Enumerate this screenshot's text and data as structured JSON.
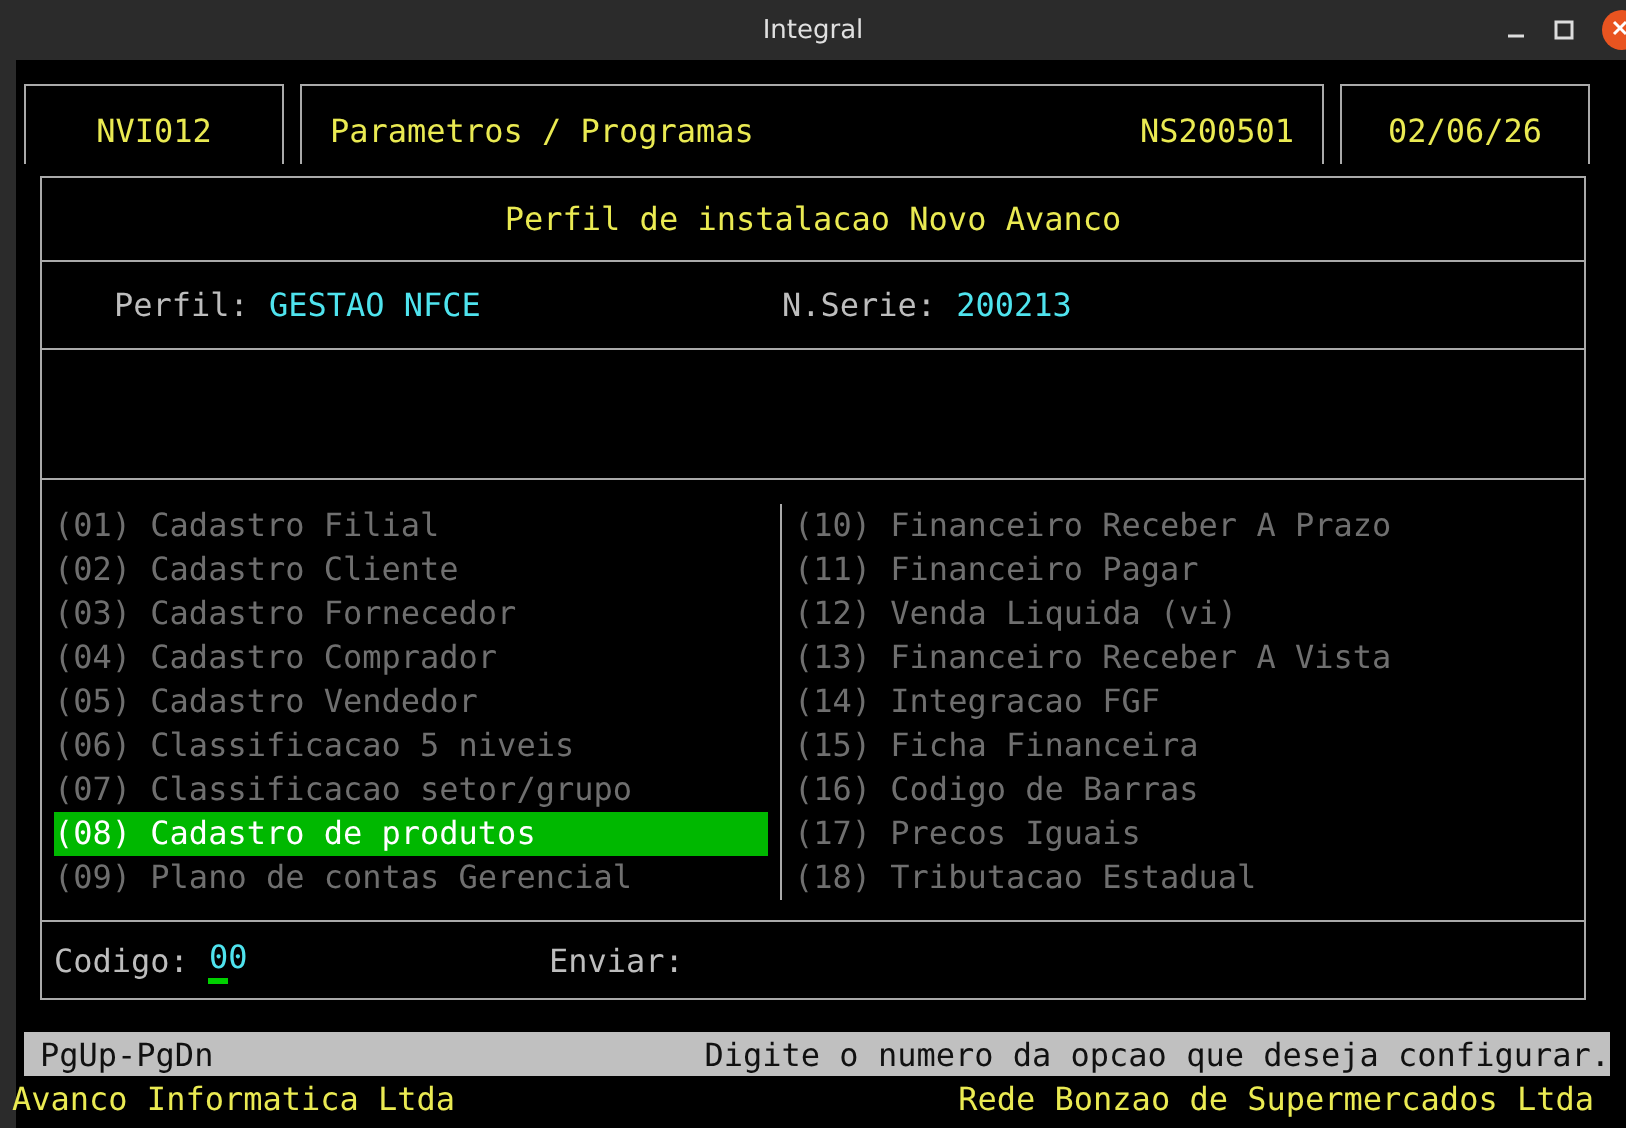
{
  "window": {
    "title": "Integral"
  },
  "header": {
    "program": "NVI012",
    "title": "Parametros / Programas",
    "code": "NS200501",
    "date": "02/06/26"
  },
  "form": {
    "title": "Perfil de instalacao Novo Avanco",
    "fields": [
      {
        "label": "Perfil:",
        "value": "GESTAO NFCE"
      },
      {
        "label": "N.Serie:",
        "value": "200213"
      }
    ]
  },
  "menu": {
    "columns": [
      [
        {
          "label": "(01) Cadastro Filial",
          "selected": false
        },
        {
          "label": "(02) Cadastro Cliente",
          "selected": false
        },
        {
          "label": "(03) Cadastro Fornecedor",
          "selected": false
        },
        {
          "label": "(04) Cadastro Comprador",
          "selected": false
        },
        {
          "label": "(05) Cadastro Vendedor",
          "selected": false
        },
        {
          "label": "(06) Classificacao 5 niveis",
          "selected": false
        },
        {
          "label": "(07) Classificacao setor/grupo",
          "selected": false
        },
        {
          "label": "(08) Cadastro de produtos",
          "selected": true
        },
        {
          "label": "(09) Plano de contas Gerencial",
          "selected": false
        }
      ],
      [
        {
          "label": "(10) Financeiro Receber A Prazo",
          "selected": false
        },
        {
          "label": "(11) Financeiro Pagar",
          "selected": false
        },
        {
          "label": "(12) Venda Liquida (vi)",
          "selected": false
        },
        {
          "label": "(13) Financeiro Receber A Vista",
          "selected": false
        },
        {
          "label": "(14) Integracao FGF",
          "selected": false
        },
        {
          "label": "(15) Ficha Financeira",
          "selected": false
        },
        {
          "label": "(16) Codigo de Barras",
          "selected": false
        },
        {
          "label": "(17) Precos Iguais",
          "selected": false
        },
        {
          "label": "(18) Tributacao Estadual",
          "selected": false
        }
      ]
    ]
  },
  "input": {
    "label": "Codigo:",
    "value": "00",
    "send_label": "Enviar:"
  },
  "status_bar": {
    "keys": "PgUp-PgDn",
    "message": "Digite o numero da opcao que deseja configurar."
  },
  "footer": {
    "left": "Avanco Informatica Ltda",
    "right": "Rede Bonzao de Supermercados Ltda"
  }
}
